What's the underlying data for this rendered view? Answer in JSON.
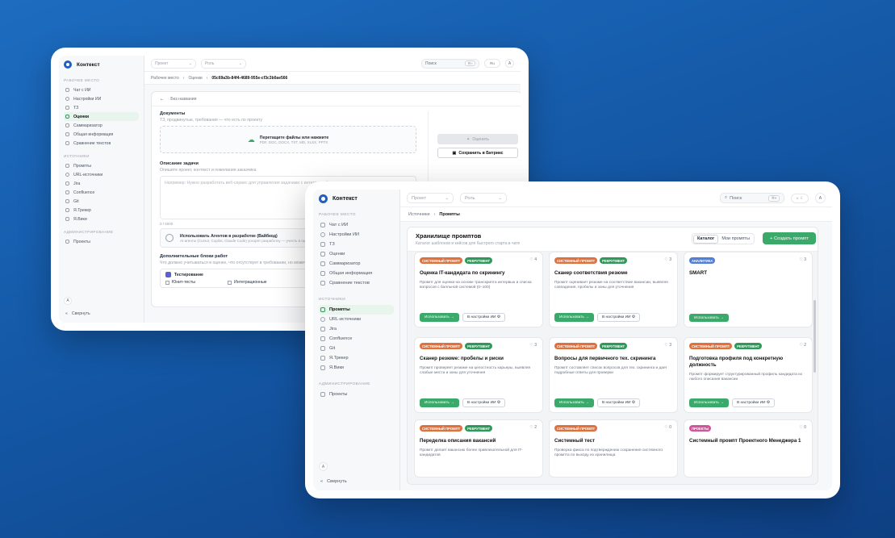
{
  "app": {
    "name": "Контекст"
  },
  "common": {
    "sections": {
      "workspace": "РАБОЧЕЕ МЕСТО",
      "sources": "ИСТОЧНИКИ",
      "admin": "АДМИНИСТРИРОВАНИЕ"
    },
    "nav": {
      "chat": "Чат с ИИ",
      "ai_settings": "Настройки ИИ",
      "tz": "ТЗ",
      "eval": "Оценки",
      "summary": "Саммаризатор",
      "general": "Общая информация",
      "compare": "Сравнение текстов",
      "prompts": "Промпты",
      "url": "URL-источники",
      "jira": "Jira",
      "confluence": "Confluence",
      "git": "Git",
      "tracker": "Я.Трекер",
      "wiki": "Я.Вики",
      "projects": "Проекты"
    },
    "collapse": "Свернуть",
    "avatar": "А",
    "project_placeholder": "Проект",
    "role_placeholder": "Роль",
    "search_placeholder": "Поиск",
    "search_kbd_back": "⌘K",
    "search_kbd_front": "⌘K",
    "lang": "Ru"
  },
  "back_screen": {
    "breadcrumb": {
      "root": "Рабочее место",
      "section": "Оценки",
      "id": "05c69a3b-84f4-4689-955e-cf3c3b0ae566"
    },
    "back_label": "Без названия",
    "documents": {
      "title": "Документы",
      "subtitle": "ТЗ, продвинутые, требования — что есть по проекту",
      "drop_title": "Перетащите файлы или нажмите",
      "drop_formats": "PDF, DOC, DOCX, TXT, MD, XLSX, PPTX"
    },
    "task": {
      "title": "Описание задачи",
      "subtitle": "Опишите проект, контекст и пожелания заказчика",
      "placeholder": "Например: Нужно разработать веб-сервис для управления задачами с интеграцией",
      "counter": "0 / 5000"
    },
    "agents": {
      "title": "Использовать Агентов в разработке (Вайбкод)",
      "subtitle": "AI-агенты (Cursor, Copilot, Claude Code) ускорят разработку — учесть в оценке"
    },
    "extra": {
      "title": "Дополнительные блоки работ",
      "subtitle": "Что должно учитываться в оценке, что отсутствует в требовании, но может на с..."
    },
    "testing": {
      "title": "Тестирование",
      "unit": "Юнит-тесты",
      "integ": "Интеграционные"
    },
    "actions": {
      "evaluate": "Оценить",
      "save_bitrix": "Сохранить в Битрикс"
    }
  },
  "front_screen": {
    "breadcrumb": {
      "root": "Источники",
      "current": "Промпты"
    },
    "header": {
      "title": "Хранилище промптов",
      "subtitle": "Каталог шаблонов и кейсов для быстрого старта в чате",
      "tab_catalog": "Каталог",
      "tab_mine": "Мои промпты",
      "create": "+ Создать промпт"
    },
    "card_actions": {
      "use": "Использовать →",
      "to_settings": "В настройки ИИ ⚙"
    },
    "cards": [
      {
        "tags": [
          {
            "label": "СИСТЕМНЫЙ ПРОМПТ",
            "kind": "sys"
          },
          {
            "label": "РЕКРУТМЕНТ",
            "kind": "rec"
          }
        ],
        "likes": "4",
        "title": "Оценка IT-кандидата по скринингу",
        "desc": "Промпт для оценки на основе транскрипта интервью и списка вопросов с балльной системой (0–100)"
      },
      {
        "tags": [
          {
            "label": "СИСТЕМНЫЙ ПРОМПТ",
            "kind": "sys"
          },
          {
            "label": "РЕКРУТМЕНТ",
            "kind": "rec"
          }
        ],
        "likes": "3",
        "title": "Сканер соответствия резюме",
        "desc": "Промпт оценивает резюме на соответствие вакансии, выявляя совпадения, пробелы и зоны для уточнения"
      },
      {
        "tags": [
          {
            "label": "АНАЛИТИКА",
            "kind": "ana"
          }
        ],
        "likes": "3",
        "title": "SMART",
        "desc": ""
      },
      {
        "tags": [
          {
            "label": "СИСТЕМНЫЙ ПРОМПТ",
            "kind": "sys"
          },
          {
            "label": "РЕКРУТМЕНТ",
            "kind": "rec"
          }
        ],
        "likes": "3",
        "title": "Сканер резюме: пробелы и риски",
        "desc": "Промпт проверяет резюме на целостность карьеры, выявляя слабые места и зоны для уточнения"
      },
      {
        "tags": [
          {
            "label": "СИСТЕМНЫЙ ПРОМПТ",
            "kind": "sys"
          },
          {
            "label": "РЕКРУТМЕНТ",
            "kind": "rec"
          }
        ],
        "likes": "3",
        "title": "Вопросы для первичного тех. скрининга",
        "desc": "Промпт составляет список вопросов для тех. скрининга и дает подробные ответы для проверки"
      },
      {
        "tags": [
          {
            "label": "СИСТЕМНЫЙ ПРОМПТ",
            "kind": "sys"
          },
          {
            "label": "РЕКРУТМЕНТ",
            "kind": "rec"
          }
        ],
        "likes": "2",
        "title": "Подготовка профиля под конкретную должность",
        "desc": "Промпт формирует структурированный профиль кандидата из любого описания вакансии"
      },
      {
        "tags": [
          {
            "label": "СИСТЕМНЫЙ ПРОМПТ",
            "kind": "sys"
          },
          {
            "label": "РЕКРУТМЕНТ",
            "kind": "rec"
          }
        ],
        "likes": "2",
        "title": "Переделка описания вакансий",
        "desc": "Промпт делает вакансию более привлекательной для IT-кандидатов"
      },
      {
        "tags": [
          {
            "label": "СИСТЕМНЫЙ ПРОМПТ",
            "kind": "sys"
          }
        ],
        "likes": "0",
        "title": "Системный тест",
        "desc": "Проверка фикса по подтверждению сохранения системного промпта по выходу из хранилища"
      },
      {
        "tags": [
          {
            "label": "ПРОЕКТЫ",
            "kind": "proj"
          }
        ],
        "likes": "0",
        "title": "Системный промпт Проектного Менеджера 1",
        "desc": ""
      }
    ]
  }
}
